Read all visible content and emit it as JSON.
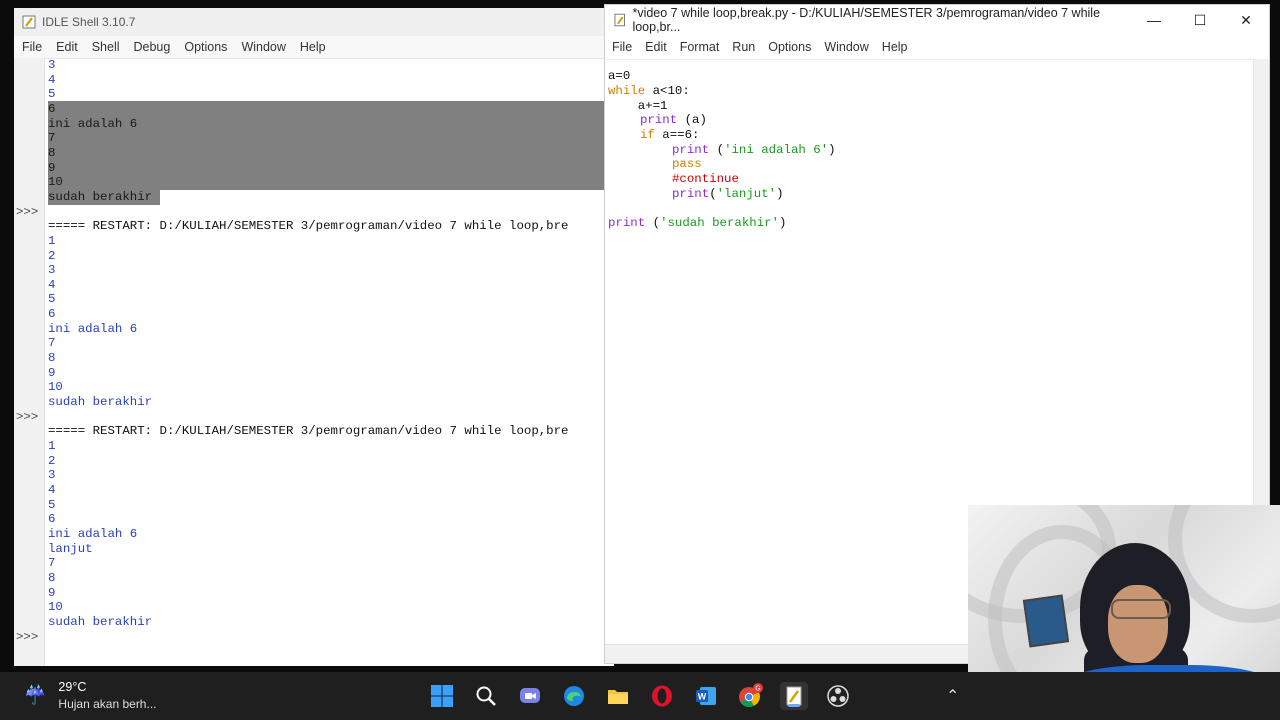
{
  "shell": {
    "title": "IDLE Shell 3.10.7",
    "menu": [
      "File",
      "Edit",
      "Shell",
      "Debug",
      "Options",
      "Window",
      "Help"
    ],
    "prompt": ">>>",
    "lines": [
      "3",
      "4",
      "5",
      "6",
      "ini adalah 6",
      "7",
      "8",
      "9",
      "10",
      "sudah berakhir",
      "===== RESTART: D:/KULIAH/SEMESTER 3/pemrograman/video 7 while loop,bre",
      "1",
      "2",
      "3",
      "4",
      "5",
      "6",
      "ini adalah 6",
      "7",
      "8",
      "9",
      "10",
      "sudah berakhir",
      "===== RESTART: D:/KULIAH/SEMESTER 3/pemrograman/video 7 while loop,bre",
      "1",
      "2",
      "3",
      "4",
      "5",
      "6",
      "ini adalah 6",
      "lanjut",
      "7",
      "8",
      "9",
      "10",
      "sudah berakhir"
    ]
  },
  "editor": {
    "title": "*video 7 while loop,break.py - D:/KULIAH/SEMESTER 3/pemrograman/video 7 while loop,br...",
    "menu": [
      "File",
      "Edit",
      "Format",
      "Run",
      "Options",
      "Window",
      "Help"
    ],
    "buttons": {
      "minimize": "—",
      "maximize": "☐",
      "close": "✕"
    },
    "code": {
      "l1": "a=0",
      "l2_kw": "while",
      "l2_rest": " a<10:",
      "l3": "    a+=1",
      "l4_bi": "print",
      "l4_rest": " (a)",
      "l5_kw": "if",
      "l5_rest": " a==6:",
      "l6_bi": "print",
      "l6_p1": " (",
      "l6_str": "'ini adalah 6'",
      "l6_p2": ")",
      "l7_kw": "pass",
      "l8_cmt": "#continue",
      "l9_bi": "print",
      "l9_p1": "(",
      "l9_str": "'lanjut'",
      "l9_p2": ")",
      "l10_bi": "print",
      "l10_p1": " (",
      "l10_str": "'sudah berakhir'",
      "l10_p2": ")"
    }
  },
  "taskbar": {
    "temp": "29°C",
    "forecast": "Hujan akan berh...",
    "apps": [
      "windows-start",
      "search",
      "teams",
      "edge",
      "file-explorer",
      "opera",
      "word",
      "chrome",
      "idle",
      "obs"
    ]
  },
  "colors": {
    "keyword": "#d07d00",
    "builtin": "#8a2be2",
    "string": "#1b9a1b",
    "comment": "#d00000",
    "output": "#2a3fbf"
  }
}
